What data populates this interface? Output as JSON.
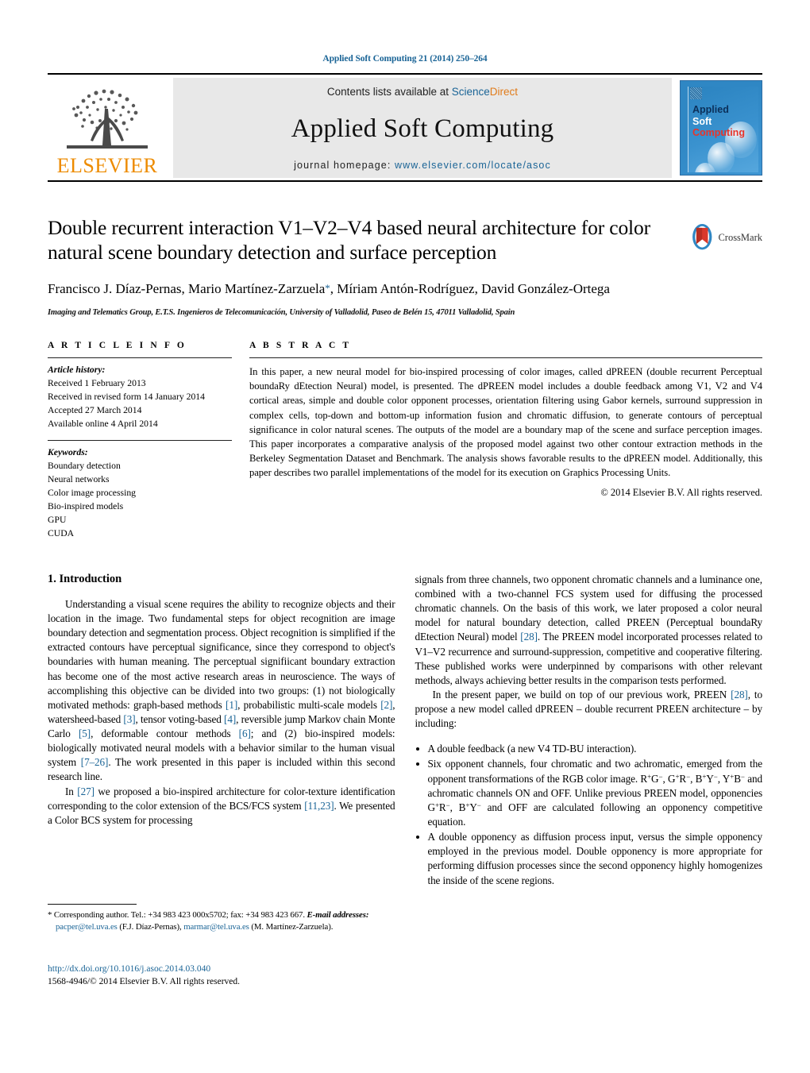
{
  "running_head": "Applied Soft Computing 21 (2014) 250–264",
  "journal_header": {
    "contents_prefix": "Contents lists available at ",
    "contents_link_a": "Science",
    "contents_link_b": "Direct",
    "journal_title": "Applied Soft Computing",
    "homepage_prefix": "journal homepage: ",
    "homepage_url": "www.elsevier.com/locate/asoc",
    "publisher_wordmark": "ELSEVIER",
    "cover": {
      "line1": "Applied",
      "line2": "Soft",
      "line3": "Computing"
    }
  },
  "article": {
    "title": "Double recurrent interaction V1–V2–V4 based neural architecture for color natural scene boundary detection and surface perception",
    "crossmark_label": "CrossMark",
    "authors": "Francisco J. Díaz-Pernas, Mario Martínez-Zarzuela",
    "authors_cont": ", Míriam Antón-Rodríguez, David González-Ortega",
    "corresponding_marker": "*",
    "affiliation": "Imaging and Telematics Group, E.T.S. Ingenieros de Telecomunicación, University of Valladolid, Paseo de Belén 15, 47011 Valladolid, Spain"
  },
  "article_info": {
    "heading": "A R T I C L E   I N F O",
    "history_label": "Article history:",
    "history": [
      "Received 1 February 2013",
      "Received in revised form 14 January 2014",
      "Accepted 27 March 2014",
      "Available online 4 April 2014"
    ],
    "keywords_label": "Keywords:",
    "keywords": [
      "Boundary detection",
      "Neural networks",
      "Color image processing",
      "Bio-inspired models",
      "GPU",
      "CUDA"
    ]
  },
  "abstract": {
    "heading": "A B S T R A C T",
    "text": "In this paper, a new neural model for bio-inspired processing of color images, called dPREEN (double recurrent Perceptual boundaRy dEtection Neural) model, is presented. The dPREEN model includes a double feedback among V1, V2 and V4 cortical areas, simple and double color opponent processes, orientation filtering using Gabor kernels, surround suppression in complex cells, top-down and bottom-up information fusion and chromatic diffusion, to generate contours of perceptual significance in color natural scenes. The outputs of the model are a boundary map of the scene and surface perception images. This paper incorporates a comparative analysis of the proposed model against two other contour extraction methods in the Berkeley Segmentation Dataset and Benchmark. The analysis shows favorable results to the dPREEN model. Additionally, this paper describes two parallel implementations of the model for its execution on Graphics Processing Units.",
    "copyright": "© 2014 Elsevier B.V. All rights reserved."
  },
  "body": {
    "section_number_title": "1.  Introduction",
    "left_paragraph_1_a": "Understanding a visual scene requires the ability to recognize objects and their location in the image. Two fundamental steps for object recognition are image boundary detection and segmentation process. Object recognition is simplified if the extracted contours have perceptual significance, since they correspond to object's boundaries with human meaning. The perceptual signifi­icant boundary extraction has become one of the most active research areas in neuroscience. The ways of accomplishing this objective can be divided into two groups: (1) not biologically motivated methods: graph-based methods ",
    "ref_1": "[1]",
    "left_paragraph_1_b": ", probabilistic multi-scale models ",
    "ref_2": "[2]",
    "left_paragraph_1_c": ", watersheed-based ",
    "ref_3": "[3]",
    "left_paragraph_1_d": ", tensor voting-based ",
    "ref_4": "[4]",
    "left_paragraph_1_e": ", reversible jump Markov chain Monte Carlo ",
    "ref_5": "[5]",
    "left_paragraph_1_f": ", deformable contour methods ",
    "ref_6": "[6]",
    "left_paragraph_1_g": "; and (2) bio-inspired models: biologically motivated neural models with a behavior similar to the human visual system ",
    "ref_7_26": "[7–26]",
    "left_paragraph_1_h": ". The work presented in this paper is included within this second research line.",
    "left_paragraph_2_a": "In ",
    "ref_27": "[27]",
    "left_paragraph_2_b": " we proposed a bio-inspired architecture for color-texture identification corresponding to the color extension of the BCS/FCS system ",
    "ref_11_23": "[11,23]",
    "left_paragraph_2_c": ". We presented a Color BCS system for processing",
    "right_paragraph_1_a": "signals from three channels, two opponent chromatic channels and a luminance one, combined with a two-channel FCS system used for diffusing the processed chromatic channels. On the basis of this work, we later proposed a color neural model for natural boundary detection, called PREEN (Perceptual boundaRy dEtection Neural) model ",
    "ref_28": "[28]",
    "right_paragraph_1_b": ". The PREEN model incorporated processes related to V1–V2 recurrence and surround-suppression, competitive and cooperative filtering. These published works were underpinned by comparisons with other relevant methods, always achieving better results in the comparison tests performed.",
    "right_paragraph_2_a": "In the present paper, we build on top of our previous work, PREEN ",
    "ref_28b": "[28]",
    "right_paragraph_2_b": ", to propose a new model called dPREEN – double recurrent PREEN architecture – by including:",
    "bullets": [
      {
        "text": "A double feedback (a new V4 TD-BU interaction)."
      },
      {
        "text_a": "Six opponent channels, four chromatic and two achromatic, emerged from the opponent transformations of the RGB color image. R",
        "sup1": "+",
        "t1": "G",
        "sup2": "−",
        "t2": ", G",
        "sup3": "+",
        "t3": "R",
        "sup4": "−",
        "t4": ", B",
        "sup5": "+",
        "t5": "Y",
        "sup6": "−",
        "t6": ", Y",
        "sup7": "+",
        "t7": "B",
        "sup8": "−",
        "t8": " and achromatic channels ON and OFF. Unlike previous PREEN model, opponencies G",
        "sup9": "+",
        "t9": "R",
        "sup10": "−",
        "t10": ", B",
        "sup11": "+",
        "t11": "Y",
        "sup12": "−",
        "t12": " and OFF are calculated following an opponency competitive equation."
      },
      {
        "text": "A double opponency as diffusion process input, versus the simple opponency employed in the previous model. Double opponency is more appropriate for performing diffusion processes since the second opponency highly homogenizes the inside of the scene regions."
      }
    ]
  },
  "footnotes": {
    "corresponding_marker": "*",
    "corresponding_text": " Corresponding author. Tel.: +34 983 423 000x5702; fax: +34 983 423 667.",
    "email_label": "E-mail addresses:",
    "email_1": "pacper@tel.uva.es",
    "email_1_owner": " (F.J. Díaz-Pernas), ",
    "email_2": "marmar@tel.uva.es",
    "email_2_owner": "(M. Martínez-Zarzuela)."
  },
  "doi_block": {
    "doi_url": "http://dx.doi.org/10.1016/j.asoc.2014.03.040",
    "issn_line": "1568-4946/© 2014 Elsevier B.V. All rights reserved."
  },
  "colors": {
    "link_blue": "#1a6496",
    "elsevier_orange": "#ED8B00",
    "cover_blue": "#2f87c4",
    "cover_red": "#e8342a"
  }
}
